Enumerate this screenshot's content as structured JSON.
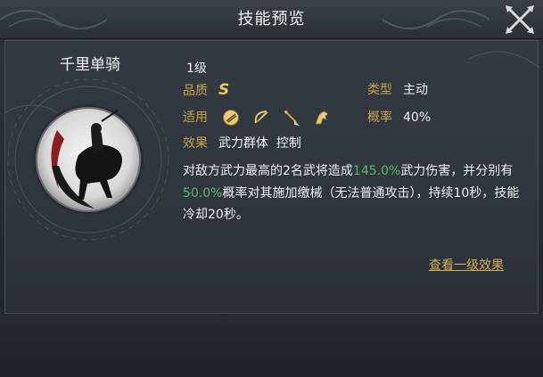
{
  "window": {
    "title": "技能预览"
  },
  "skill": {
    "name": "千里单骑",
    "level": "1级",
    "quality_label": "品质",
    "quality_value": "S",
    "type_label": "类型",
    "type_value": "主动",
    "applicable_label": "适用",
    "applicable_icons": [
      "cavalry-icon",
      "archer-icon",
      "spear-icon",
      "horse-icon"
    ],
    "rate_label": "概率",
    "rate_value": "40%",
    "effect_label": "效果",
    "effect_value": "武力群体  控制",
    "description": {
      "part1": "对敌方武力最高的2名武将造成",
      "value1": "145.0%",
      "part2": "武力伤害，并分别有",
      "value2": "50.0%",
      "part3": "概率对其施加缴械（无法普通攻击），持续10秒，技能冷却20秒。"
    }
  },
  "actions": {
    "view_level1": "查看一级效果"
  },
  "colors": {
    "label": "#c9a24a",
    "highlight": "#58b86a",
    "quality": "#e8c95a",
    "link": "#d3ad55"
  }
}
